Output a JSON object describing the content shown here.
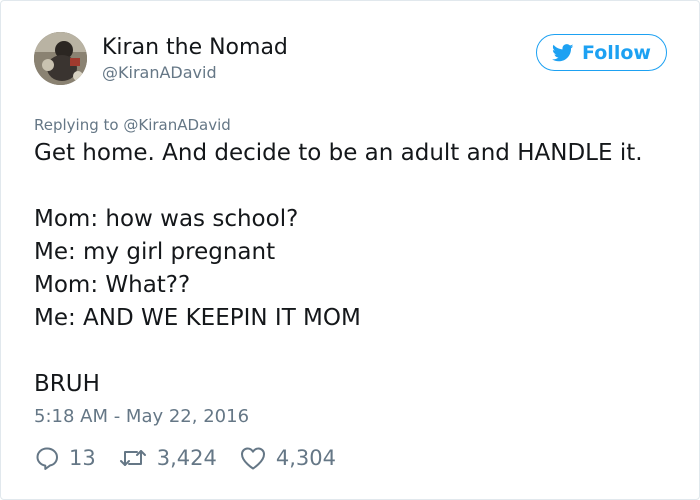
{
  "user": {
    "display_name": "Kiran the Nomad",
    "handle": "@KiranADavid",
    "avatar_icon": "profile-photo"
  },
  "follow_button": {
    "label": "Follow",
    "icon": "twitter-bird-icon",
    "accent_color": "#1da1f2"
  },
  "reply_context": {
    "prefix": "Replying to",
    "mention": "@KiranADavid"
  },
  "tweet": {
    "lines": [
      "Get home. And decide to be an adult and HANDLE it.",
      "",
      "Mom: how was school?",
      "Me: my girl pregnant",
      "Mom: What??",
      "Me: AND WE KEEPIN IT MOM",
      "",
      "BRUH"
    ],
    "timestamp": "5:18 AM - May 22, 2016"
  },
  "actions": {
    "reply": {
      "icon": "reply-icon",
      "count": "13"
    },
    "retweet": {
      "icon": "retweet-icon",
      "count": "3,424"
    },
    "like": {
      "icon": "heart-icon",
      "count": "4,304"
    }
  },
  "colors": {
    "text": "#14171a",
    "secondary": "#657786",
    "border": "#e1e8ed"
  }
}
